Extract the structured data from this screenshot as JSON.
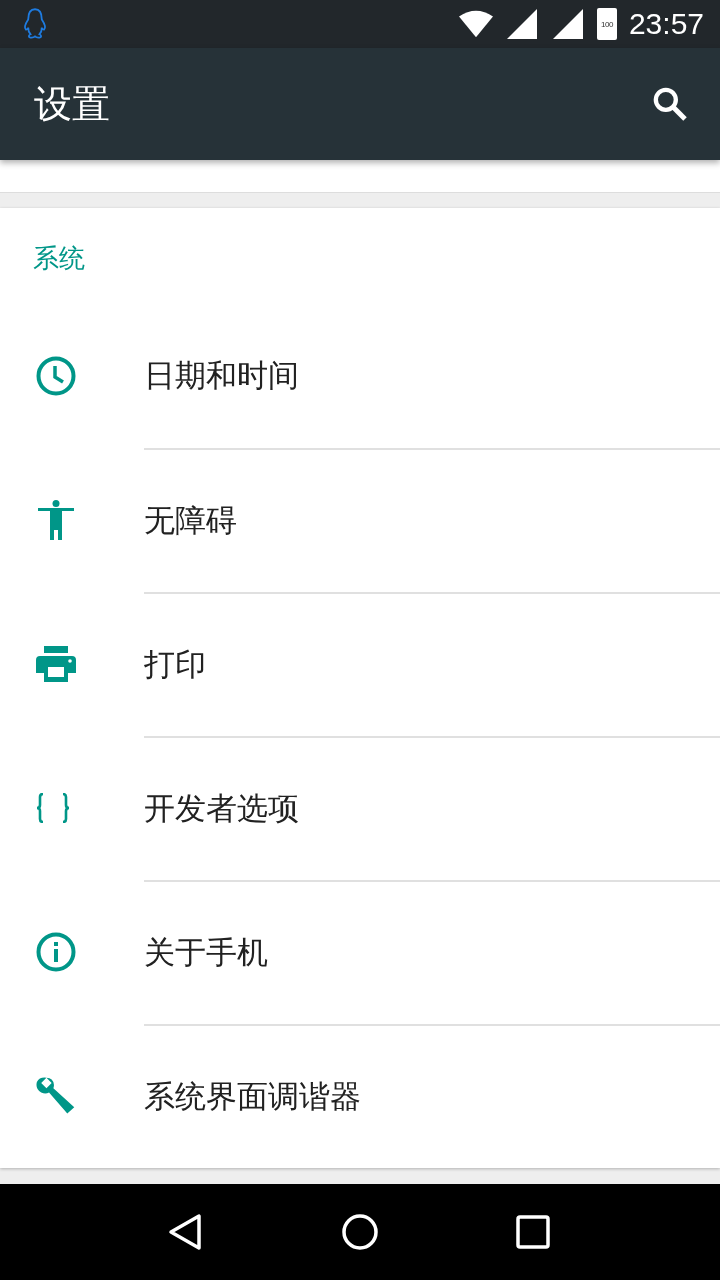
{
  "status_bar": {
    "battery_text": "100",
    "time": "23:57"
  },
  "app_bar": {
    "title": "设置"
  },
  "section": {
    "title": "系统",
    "items": [
      {
        "kind": "clock",
        "label": "日期和时间"
      },
      {
        "kind": "accessibility",
        "label": "无障碍"
      },
      {
        "kind": "print",
        "label": "打印"
      },
      {
        "kind": "braces",
        "label": "开发者选项"
      },
      {
        "kind": "info",
        "label": "关于手机"
      },
      {
        "kind": "wrench",
        "label": "系统界面调谐器"
      }
    ]
  }
}
